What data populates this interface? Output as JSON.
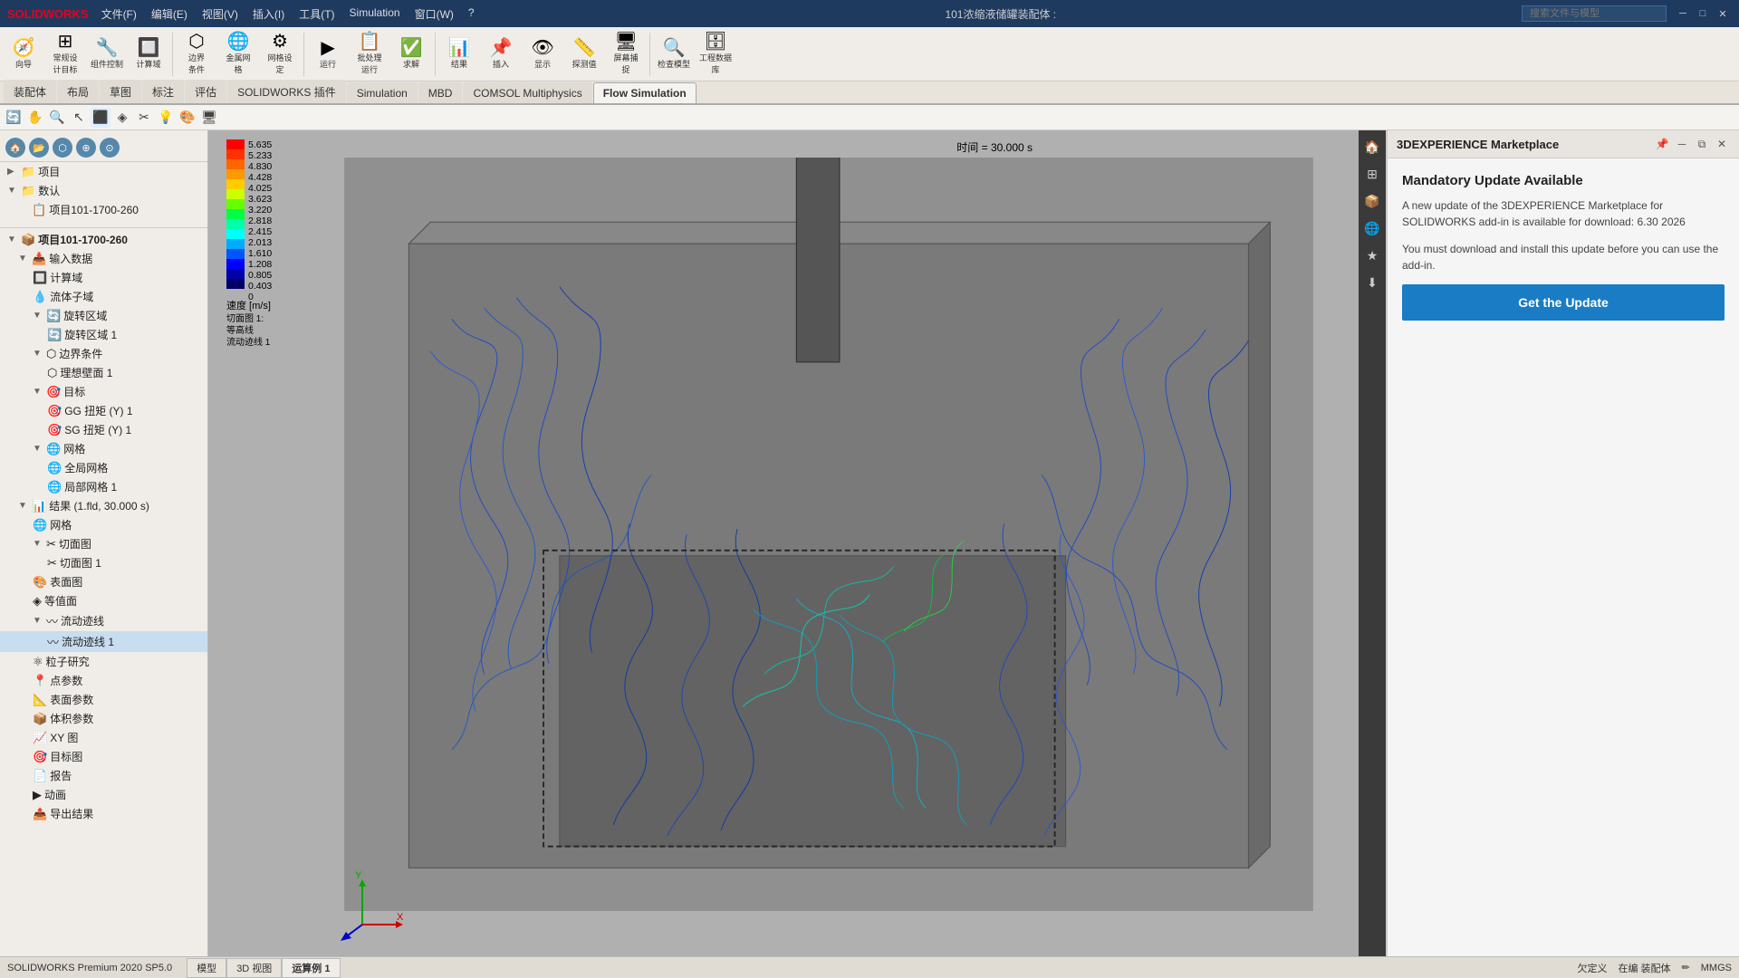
{
  "titlebar": {
    "logo": "SOLIDWORKS",
    "menus": [
      "文件(F)",
      "编辑(E)",
      "视图(V)",
      "插入(I)",
      "工具(T)",
      "Simulation",
      "窗口(W)",
      "?"
    ],
    "title": "101浓缩液储罐装配体 :",
    "search_placeholder": "搜索文件与模型"
  },
  "toolbar1": {
    "groups": [
      {
        "icon": "🧭",
        "label": "向导"
      },
      {
        "icon": "🔧",
        "label": "常规设\n计目标"
      },
      {
        "icon": "📦",
        "label": "组件控制"
      },
      {
        "icon": "🔲",
        "label": "计算域"
      },
      {
        "icon": "⚙️",
        "label": "边界\n条件"
      },
      {
        "icon": "🌐",
        "label": "金属网\n格"
      },
      {
        "icon": "⚙️",
        "label": "网格设\n定"
      },
      {
        "icon": "▶",
        "label": "运行"
      },
      {
        "icon": "📋",
        "label": "批处理\n运行"
      },
      {
        "icon": "✅",
        "label": "求解"
      },
      {
        "icon": "📊",
        "label": "结果"
      },
      {
        "icon": "📌",
        "label": "插入"
      },
      {
        "icon": "👁",
        "label": "显示"
      },
      {
        "icon": "📏",
        "label": "探测值"
      },
      {
        "icon": "🖥",
        "label": "屏幕捕\n捉"
      },
      {
        "icon": "🔍",
        "label": "检查模型"
      },
      {
        "icon": "🗄",
        "label": "工程数据\n库"
      }
    ]
  },
  "tabs": [
    {
      "label": "装配体",
      "active": false
    },
    {
      "label": "布局",
      "active": false
    },
    {
      "label": "草图",
      "active": false
    },
    {
      "label": "标注",
      "active": false
    },
    {
      "label": "评估",
      "active": false
    },
    {
      "label": "SOLIDWORKS 插件",
      "active": false
    },
    {
      "label": "Simulation",
      "active": false
    },
    {
      "label": "MBD",
      "active": false
    },
    {
      "label": "COMSOL Multiphysics",
      "active": false
    },
    {
      "label": "Flow Simulation",
      "active": true
    }
  ],
  "toolbar2": {
    "buttons": [
      "🔍",
      "🔧",
      "🖱",
      "📐",
      "📦",
      "🔷",
      "💧",
      "🎨",
      "🖥",
      "⬛"
    ]
  },
  "tree": {
    "header_icons": [
      "🏠",
      "📂",
      "⬡",
      "⊕",
      "⊙"
    ],
    "items": [
      {
        "level": 0,
        "label": "项目",
        "icon": "📁",
        "arrow": "▶"
      },
      {
        "level": 0,
        "label": "数认",
        "icon": "📁",
        "arrow": "▼"
      },
      {
        "level": 1,
        "label": "项目101-1700-260",
        "icon": "📋",
        "arrow": ""
      },
      {
        "level": 0,
        "label": "项目101-1700-260",
        "icon": "📦",
        "arrow": "▼",
        "bold": true
      },
      {
        "level": 1,
        "label": "输入数据",
        "icon": "📥",
        "arrow": "▼"
      },
      {
        "level": 2,
        "label": "计算域",
        "icon": "🔲",
        "arrow": ""
      },
      {
        "level": 2,
        "label": "流体子域",
        "icon": "💧",
        "arrow": ""
      },
      {
        "level": 2,
        "label": "旋转区域",
        "icon": "🔄",
        "arrow": "▼"
      },
      {
        "level": 3,
        "label": "旋转区域 1",
        "icon": "🔄",
        "arrow": ""
      },
      {
        "level": 2,
        "label": "边界条件",
        "icon": "⬡",
        "arrow": "▼"
      },
      {
        "level": 3,
        "label": "理想壁面 1",
        "icon": "⬡",
        "arrow": ""
      },
      {
        "level": 2,
        "label": "目标",
        "icon": "🎯",
        "arrow": "▼"
      },
      {
        "level": 3,
        "label": "GG 扭矩 (Y) 1",
        "icon": "🎯",
        "arrow": ""
      },
      {
        "level": 3,
        "label": "SG 扭矩 (Y) 1",
        "icon": "🎯",
        "arrow": ""
      },
      {
        "level": 2,
        "label": "网格",
        "icon": "🌐",
        "arrow": "▼"
      },
      {
        "level": 3,
        "label": "全局网格",
        "icon": "🌐",
        "arrow": ""
      },
      {
        "level": 3,
        "label": "局部网格 1",
        "icon": "🌐",
        "arrow": ""
      },
      {
        "level": 1,
        "label": "结果 (1.fld, 30.000 s)",
        "icon": "📊",
        "arrow": "▼"
      },
      {
        "level": 2,
        "label": "网格",
        "icon": "🌐",
        "arrow": ""
      },
      {
        "level": 2,
        "label": "切面图",
        "icon": "✂",
        "arrow": "▼"
      },
      {
        "level": 3,
        "label": "切面图 1",
        "icon": "✂",
        "arrow": ""
      },
      {
        "level": 2,
        "label": "表面图",
        "icon": "🎨",
        "arrow": ""
      },
      {
        "level": 2,
        "label": "等值面",
        "icon": "◈",
        "arrow": ""
      },
      {
        "level": 2,
        "label": "流动迹线",
        "icon": "〰",
        "arrow": "▼"
      },
      {
        "level": 3,
        "label": "流动迹线 1",
        "icon": "〰",
        "arrow": ""
      },
      {
        "level": 2,
        "label": "粒子研究",
        "icon": "⚛",
        "arrow": ""
      },
      {
        "level": 2,
        "label": "点参数",
        "icon": "📍",
        "arrow": ""
      },
      {
        "level": 2,
        "label": "表面参数",
        "icon": "📐",
        "arrow": ""
      },
      {
        "level": 2,
        "label": "体积参数",
        "icon": "📦",
        "arrow": ""
      },
      {
        "level": 2,
        "label": "XY 图",
        "icon": "📈",
        "arrow": ""
      },
      {
        "level": 2,
        "label": "目标图",
        "icon": "🎯",
        "arrow": ""
      },
      {
        "level": 2,
        "label": "报告",
        "icon": "📄",
        "arrow": ""
      },
      {
        "level": 2,
        "label": "动画",
        "icon": "▶",
        "arrow": ""
      },
      {
        "level": 2,
        "label": "导出结果",
        "icon": "📤",
        "arrow": ""
      }
    ]
  },
  "legend": {
    "values": [
      "5.635",
      "5.233",
      "4.830",
      "4.428",
      "4.025",
      "3.623",
      "3.220",
      "2.818",
      "2.415",
      "2.013",
      "1.610",
      "1.208",
      "0.805",
      "0.403",
      "0"
    ],
    "title": "速度 [m/s]",
    "subtitle_line1": "切面图 1: 等高线",
    "subtitle_line2": "流动迹线 1"
  },
  "viewport": {
    "time_label": "时间 = 30.000 s",
    "section_label": "切面图 1: 等高线\n流动迹线 1"
  },
  "marketplace": {
    "panel_title": "3DEXPERIENCE Marketplace",
    "update_title": "Mandatory Update Available",
    "update_body1": "A new update of the 3DEXPERIENCE Marketplace for SOLIDWORKS add-in is available for download: 6.30 2026",
    "update_body2": "You must download and install this update before you can use the add-in.",
    "update_button": "Get the Update"
  },
  "statusbar": {
    "sw_version": "SOLIDWORKS Premium 2020 SP5.0",
    "tabs": [
      "模型",
      "3D 视图",
      "运算例 1"
    ],
    "active_tab": "运算例 1",
    "status": "欠定义",
    "mode": "在编 装配体",
    "units": "MMGS"
  }
}
